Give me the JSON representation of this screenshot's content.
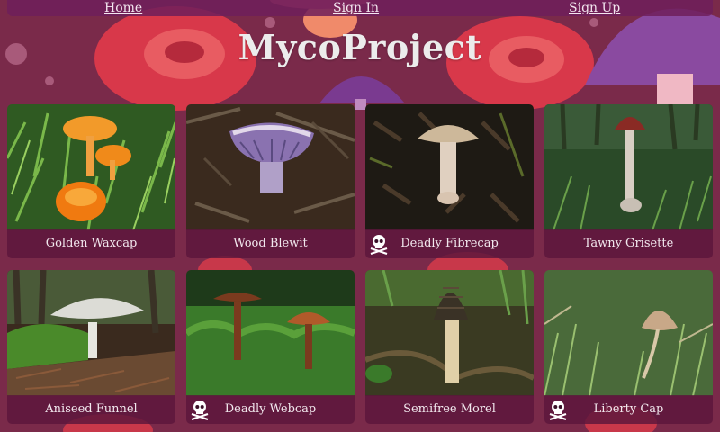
{
  "nav": {
    "home": "Home",
    "sign_in": "Sign In",
    "sign_up": "Sign Up"
  },
  "brand": "MycoProject",
  "colors": {
    "background": "#7a2a4a",
    "nav_bar": "#6e1e5a",
    "card_label_bar": "#5c163c",
    "text_light": "#f2e8ee"
  },
  "cards": [
    {
      "name": "Golden Waxcap",
      "poisonous": false,
      "icon": ""
    },
    {
      "name": "Wood Blewit",
      "poisonous": false,
      "icon": ""
    },
    {
      "name": "Deadly Fibrecap",
      "poisonous": true,
      "icon": "skull-crossbones-icon"
    },
    {
      "name": "Tawny Grisette",
      "poisonous": false,
      "icon": ""
    },
    {
      "name": "Aniseed Funnel",
      "poisonous": false,
      "icon": ""
    },
    {
      "name": "Deadly Webcap",
      "poisonous": true,
      "icon": "skull-crossbones-icon"
    },
    {
      "name": "Semifree Morel",
      "poisonous": false,
      "icon": ""
    },
    {
      "name": "Liberty Cap",
      "poisonous": true,
      "icon": "skull-crossbones-icon"
    }
  ]
}
